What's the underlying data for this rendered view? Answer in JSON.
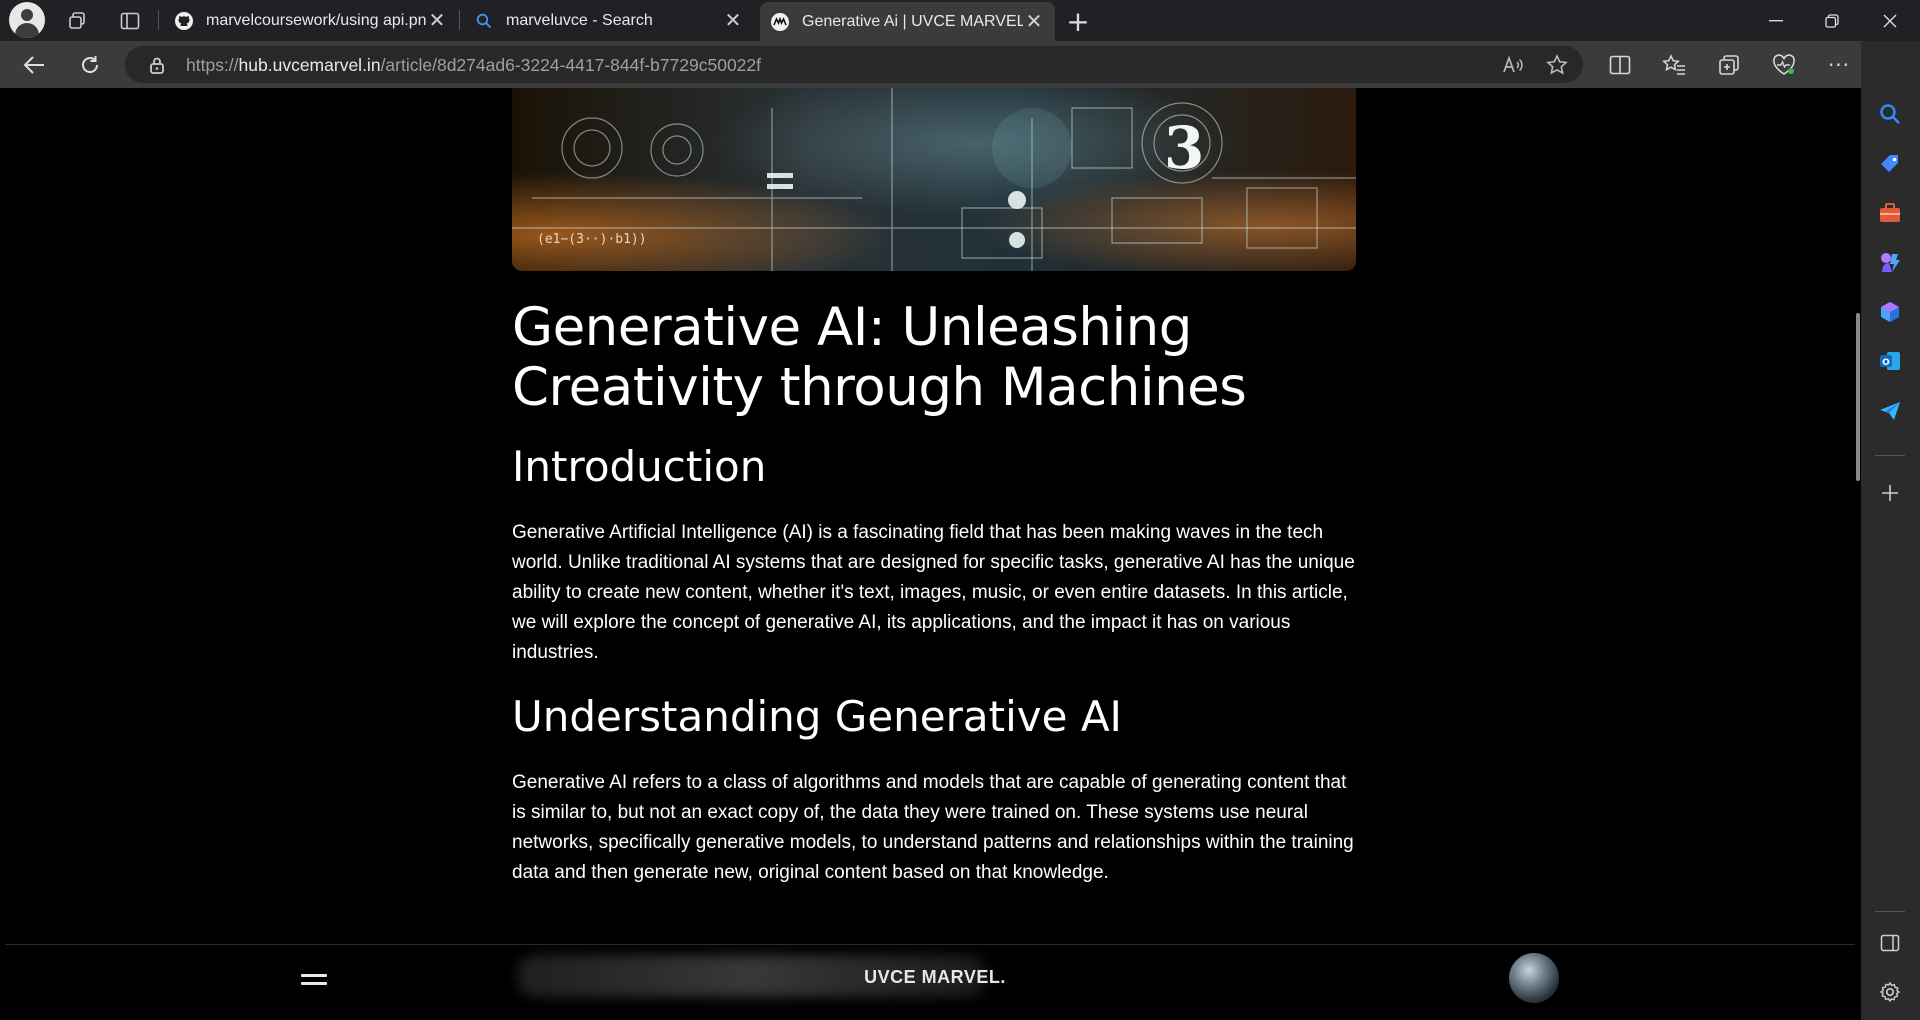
{
  "browser": {
    "tabs": [
      {
        "title": "marvelcoursework/using api.png",
        "favicon": "github-icon",
        "active": false
      },
      {
        "title": "marveluvce - Search",
        "favicon": "search-icon",
        "active": false
      },
      {
        "title": "Generative Ai | UVCE MARVEL",
        "favicon": "uvce-marvel-icon",
        "active": true
      }
    ],
    "url": {
      "scheme": "https://",
      "host": "hub.uvcemarvel.in",
      "path": "/article/8d274ad6-3224-4417-844f-b7729c50022f"
    },
    "new_tab_label": "+",
    "colors": {
      "tabstrip": "#202124",
      "toolbar": "#3b3b3b",
      "active_tab": "#3b3b3b",
      "sidebar": "#2b2b2b"
    }
  },
  "article": {
    "title": "Generative AI: Unleashing Creativity through Machines",
    "sections": [
      {
        "heading": "Introduction",
        "body": "Generative Artificial Intelligence (AI) is a fascinating field that has been making waves in the tech world. Unlike traditional AI systems that are designed for specific tasks, generative AI has the unique ability to create new content, whether it's text, images, music, or even entire datasets. In this article, we will explore the concept of generative AI, its applications, and the impact it has on various industries."
      },
      {
        "heading": "Understanding Generative AI",
        "body": "Generative AI refers to a class of algorithms and models that are capable of generating content that is similar to, but not an exact copy of, the data they were trained on. These systems use neural networks, specifically generative models, to understand patterns and relationships within the training data and then generate new, original content based on that knowledge."
      }
    ],
    "hero_image_text": {
      "numeral": "3",
      "formula": "(e1−(3··)·b1))"
    }
  },
  "site_nav": {
    "brand": "UVCE MARVEL.",
    "menu_icon": "hamburger-menu-icon",
    "avatar": "user-avatar"
  }
}
